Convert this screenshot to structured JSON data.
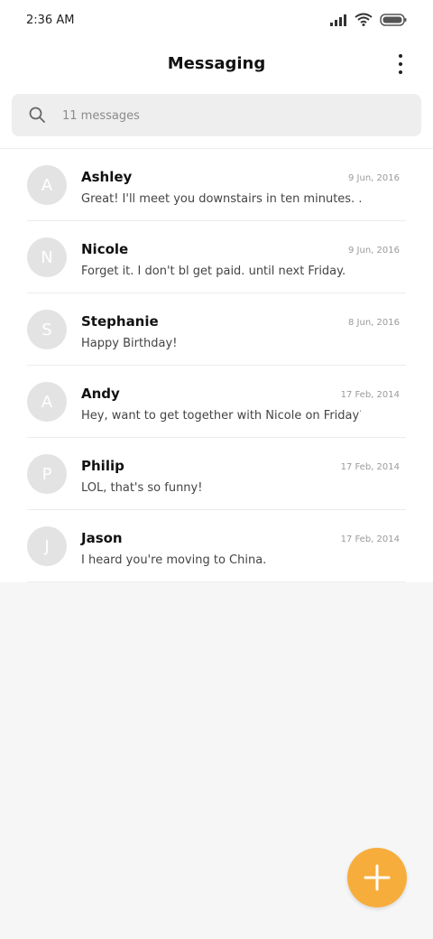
{
  "status_bar": {
    "time": "2:36 AM"
  },
  "header": {
    "title": "Messaging"
  },
  "search": {
    "placeholder": "11 messages"
  },
  "conversations": [
    {
      "initial": "A",
      "name": "Ashley",
      "date": "9 Jun, 2016",
      "preview": "Great! I'll meet you downstairs in ten minutes. ..."
    },
    {
      "initial": "N",
      "name": "Nicole",
      "date": "9 Jun, 2016",
      "preview": "Forget it. I don't bl get paid. until next Friday."
    },
    {
      "initial": "S",
      "name": "Stephanie",
      "date": "8 Jun, 2016",
      "preview": "Happy Birthday!"
    },
    {
      "initial": "A",
      "name": "Andy",
      "date": "17 Feb, 2014",
      "preview": "Hey, want to get together with Nicole on Friday?"
    },
    {
      "initial": "P",
      "name": "Philip",
      "date": "17 Feb, 2014",
      "preview": "LOL, that's so funny!"
    },
    {
      "initial": "J",
      "name": "Jason",
      "date": "17 Feb, 2014",
      "preview": "I heard you're moving to China."
    }
  ],
  "colors": {
    "accent": "#f7ad3c",
    "avatar_bg": "#e3e3e3",
    "background": "#f6f6f6"
  },
  "icons": {
    "signal": "signal-icon",
    "wifi": "wifi-icon",
    "battery": "battery-icon",
    "search": "search-icon",
    "more": "more-vert-icon",
    "compose": "plus-icon"
  }
}
